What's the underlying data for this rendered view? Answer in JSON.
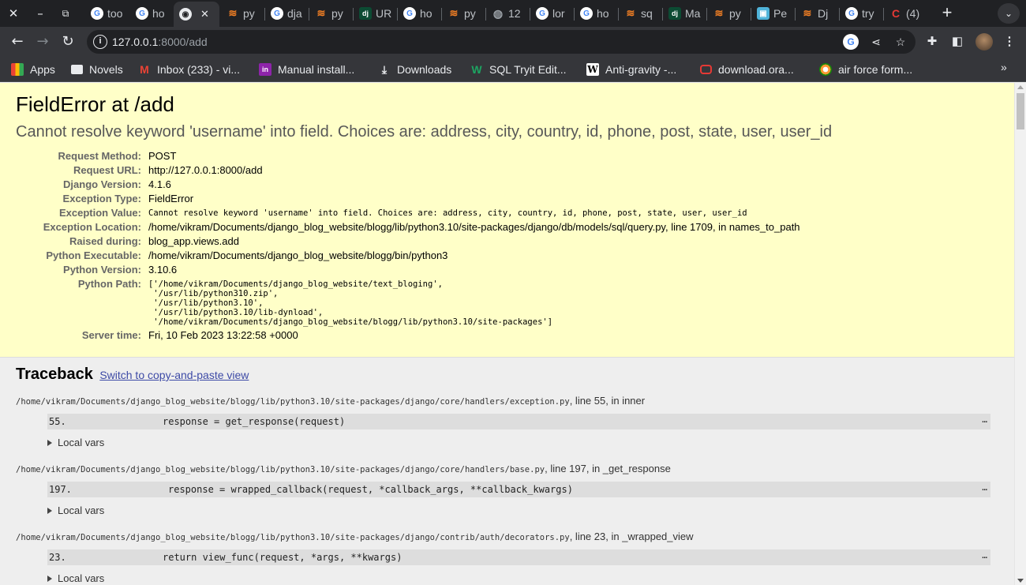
{
  "browser": {
    "tabs": [
      {
        "label": "too",
        "icon": "google-icon"
      },
      {
        "label": "ho",
        "icon": "google-icon"
      },
      {
        "label": "",
        "icon": "chrome-icon",
        "active": true
      },
      {
        "label": "py",
        "icon": "stackoverflow-icon"
      },
      {
        "label": "dja",
        "icon": "google-icon"
      },
      {
        "label": "py",
        "icon": "stackoverflow-icon"
      },
      {
        "label": "UR",
        "icon": "django-icon"
      },
      {
        "label": "ho",
        "icon": "google-icon"
      },
      {
        "label": "py",
        "icon": "stackoverflow-icon"
      },
      {
        "label": "12",
        "icon": "globe-icon"
      },
      {
        "label": "lor",
        "icon": "google-icon"
      },
      {
        "label": "ho",
        "icon": "google-icon"
      },
      {
        "label": "sq",
        "icon": "stackoverflow-icon"
      },
      {
        "label": "Ma",
        "icon": "django-icon"
      },
      {
        "label": "py",
        "icon": "stackoverflow-icon"
      },
      {
        "label": "Pe",
        "icon": "cube-icon"
      },
      {
        "label": "Dj",
        "icon": "stackoverflow-icon"
      },
      {
        "label": "try",
        "icon": "google-icon"
      },
      {
        "label": "(4)",
        "icon": "red-c-icon"
      }
    ],
    "url_host": "127.0.0.1",
    "url_path": ":8000/add",
    "bookmarks": [
      {
        "label": "Apps",
        "icon": "apps-icon"
      },
      {
        "label": "Novels",
        "icon": "folder-icon"
      },
      {
        "label": "Inbox (233) - vi...",
        "icon": "gmail-icon"
      },
      {
        "label": "Manual install...",
        "icon": "inkind-icon"
      },
      {
        "label": "Downloads",
        "icon": "download-icon"
      },
      {
        "label": "SQL Tryit Edit...",
        "icon": "w3schools-icon"
      },
      {
        "label": "Anti-gravity -...",
        "icon": "wikipedia-icon"
      },
      {
        "label": "download.ora...",
        "icon": "oracle-icon"
      },
      {
        "label": "air force form...",
        "icon": "india-flag-icon"
      }
    ]
  },
  "error": {
    "title": "FieldError at /add",
    "message": "Cannot resolve keyword 'username' into field. Choices are: address, city, country, id, phone, post, state, user, user_id",
    "meta": {
      "request_method_label": "Request Method:",
      "request_method": "POST",
      "request_url_label": "Request URL:",
      "request_url": "http://127.0.0.1:8000/add",
      "django_version_label": "Django Version:",
      "django_version": "4.1.6",
      "exception_type_label": "Exception Type:",
      "exception_type": "FieldError",
      "exception_value_label": "Exception Value:",
      "exception_value": "Cannot resolve keyword 'username' into field. Choices are: address, city, country, id, phone, post, state, user, user_id",
      "exception_location_label": "Exception Location:",
      "exception_location": "/home/vikram/Documents/django_blog_website/blogg/lib/python3.10/site-packages/django/db/models/sql/query.py, line 1709, in names_to_path",
      "raised_during_label": "Raised during:",
      "raised_during": "blog_app.views.add",
      "python_executable_label": "Python Executable:",
      "python_executable": "/home/vikram/Documents/django_blog_website/blogg/bin/python3",
      "python_version_label": "Python Version:",
      "python_version": "3.10.6",
      "python_path_label": "Python Path:",
      "python_path": "['/home/vikram/Documents/django_blog_website/text_bloging',\n '/usr/lib/python310.zip',\n '/usr/lib/python3.10',\n '/usr/lib/python3.10/lib-dynload',\n '/home/vikram/Documents/django_blog_website/blogg/lib/python3.10/site-packages']",
      "server_time_label": "Server time:",
      "server_time": "Fri, 10 Feb 2023 13:22:58 +0000"
    }
  },
  "traceback": {
    "title": "Traceback",
    "switch_link": "Switch to copy-and-paste view",
    "local_vars_label": "Local vars",
    "frames": [
      {
        "file": "/home/vikram/Documents/django_blog_website/blogg/lib/python3.10/site-packages/django/core/handlers/exception.py",
        "where": ", line 55, in inner",
        "lineno": "55.",
        "code": "response = get_response(request)"
      },
      {
        "file": "/home/vikram/Documents/django_blog_website/blogg/lib/python3.10/site-packages/django/core/handlers/base.py",
        "where": ", line 197, in _get_response",
        "lineno": "197.",
        "code": "response = wrapped_callback(request, *callback_args, **callback_kwargs)"
      },
      {
        "file": "/home/vikram/Documents/django_blog_website/blogg/lib/python3.10/site-packages/django/contrib/auth/decorators.py",
        "where": ", line 23, in _wrapped_view",
        "lineno": "23.",
        "code": "return view_func(request, *args, **kwargs)"
      }
    ]
  }
}
